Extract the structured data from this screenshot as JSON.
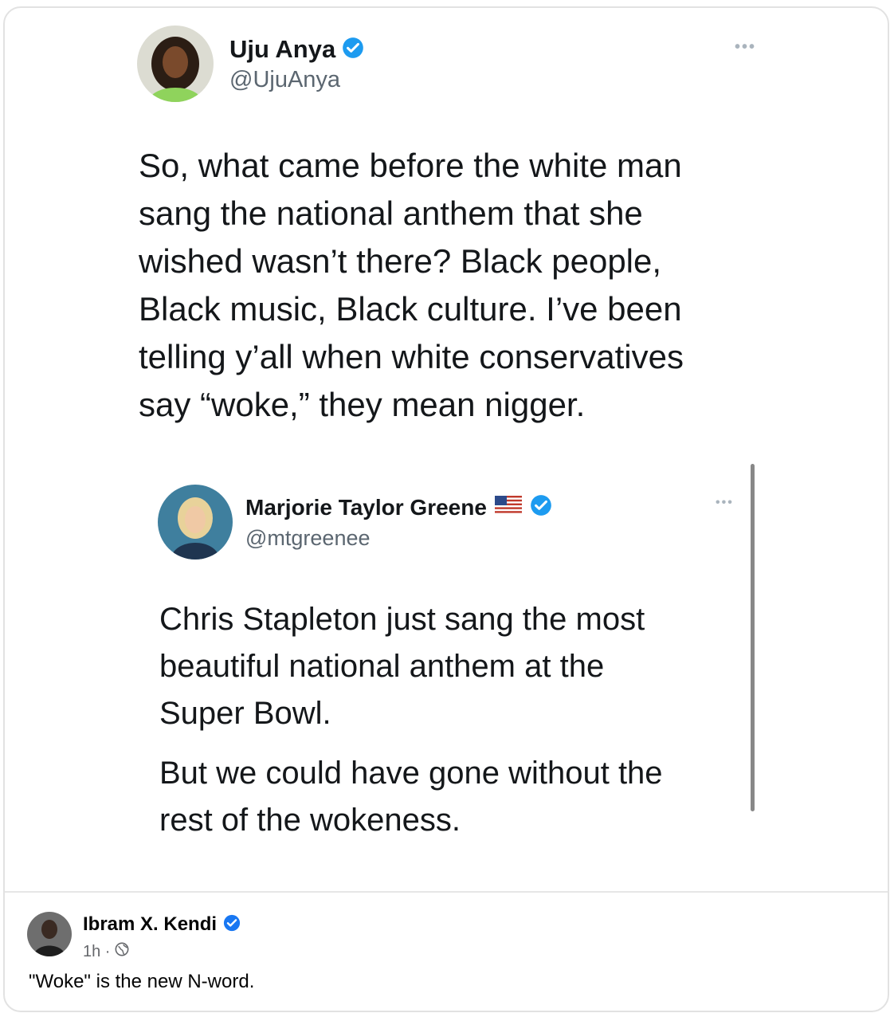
{
  "main_tweet": {
    "author_name": "Uju Anya",
    "handle": "@UjuAnya",
    "verified": true,
    "more_icon": "more-horizontal-icon",
    "text_lines": [
      "So, what came before the white man",
      "sang the national anthem that she",
      "wished wasn’t there? Black people,",
      "Black music, Black culture. I’ve been",
      "telling y’all when white conservatives",
      "say “woke,” they mean nigger."
    ]
  },
  "quoted_tweet": {
    "author_name": "Marjorie Taylor Greene",
    "flag_icon": "us-flag-icon",
    "handle": "@mtgreenee",
    "verified": true,
    "paragraph1_lines": [
      "Chris Stapleton just sang the most",
      "beautiful national anthem at the",
      "Super Bowl."
    ],
    "paragraph2_lines": [
      "But we could have gone without the",
      "rest of the wokeness."
    ]
  },
  "post": {
    "author_name": "Ibram X. Kendi",
    "verified": true,
    "time": "1h ·",
    "privacy_icon": "globe-icon",
    "text": "\"Woke\" is the new N-word."
  },
  "colors": {
    "verified_blue": "#1d9bf0",
    "facebook_blue": "#1877f2",
    "handle_gray": "#5b6670",
    "border": "#e2e2e2"
  }
}
